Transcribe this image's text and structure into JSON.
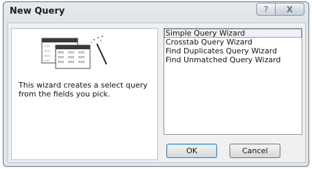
{
  "window": {
    "title": "New Query",
    "help_icon": "question-mark-icon",
    "close_icon": "close-x-icon",
    "help_glyph": "?",
    "close_glyph": "X"
  },
  "preview": {
    "illustration": "query-wizard-grid-icon",
    "grid_cell_text": "xxx",
    "description": "This wizard creates a select query from the fields you pick."
  },
  "wizard_list": {
    "items": [
      {
        "label": "Simple Query Wizard",
        "selected": true
      },
      {
        "label": "Crosstab Query Wizard",
        "selected": false
      },
      {
        "label": "Find Duplicates Query Wizard",
        "selected": false
      },
      {
        "label": "Find Unmatched Query Wizard",
        "selected": false
      }
    ]
  },
  "buttons": {
    "ok_label": "OK",
    "cancel_label": "Cancel"
  },
  "colors": {
    "selection_outline": "#444444",
    "default_button_border": "#3c7fb1"
  }
}
